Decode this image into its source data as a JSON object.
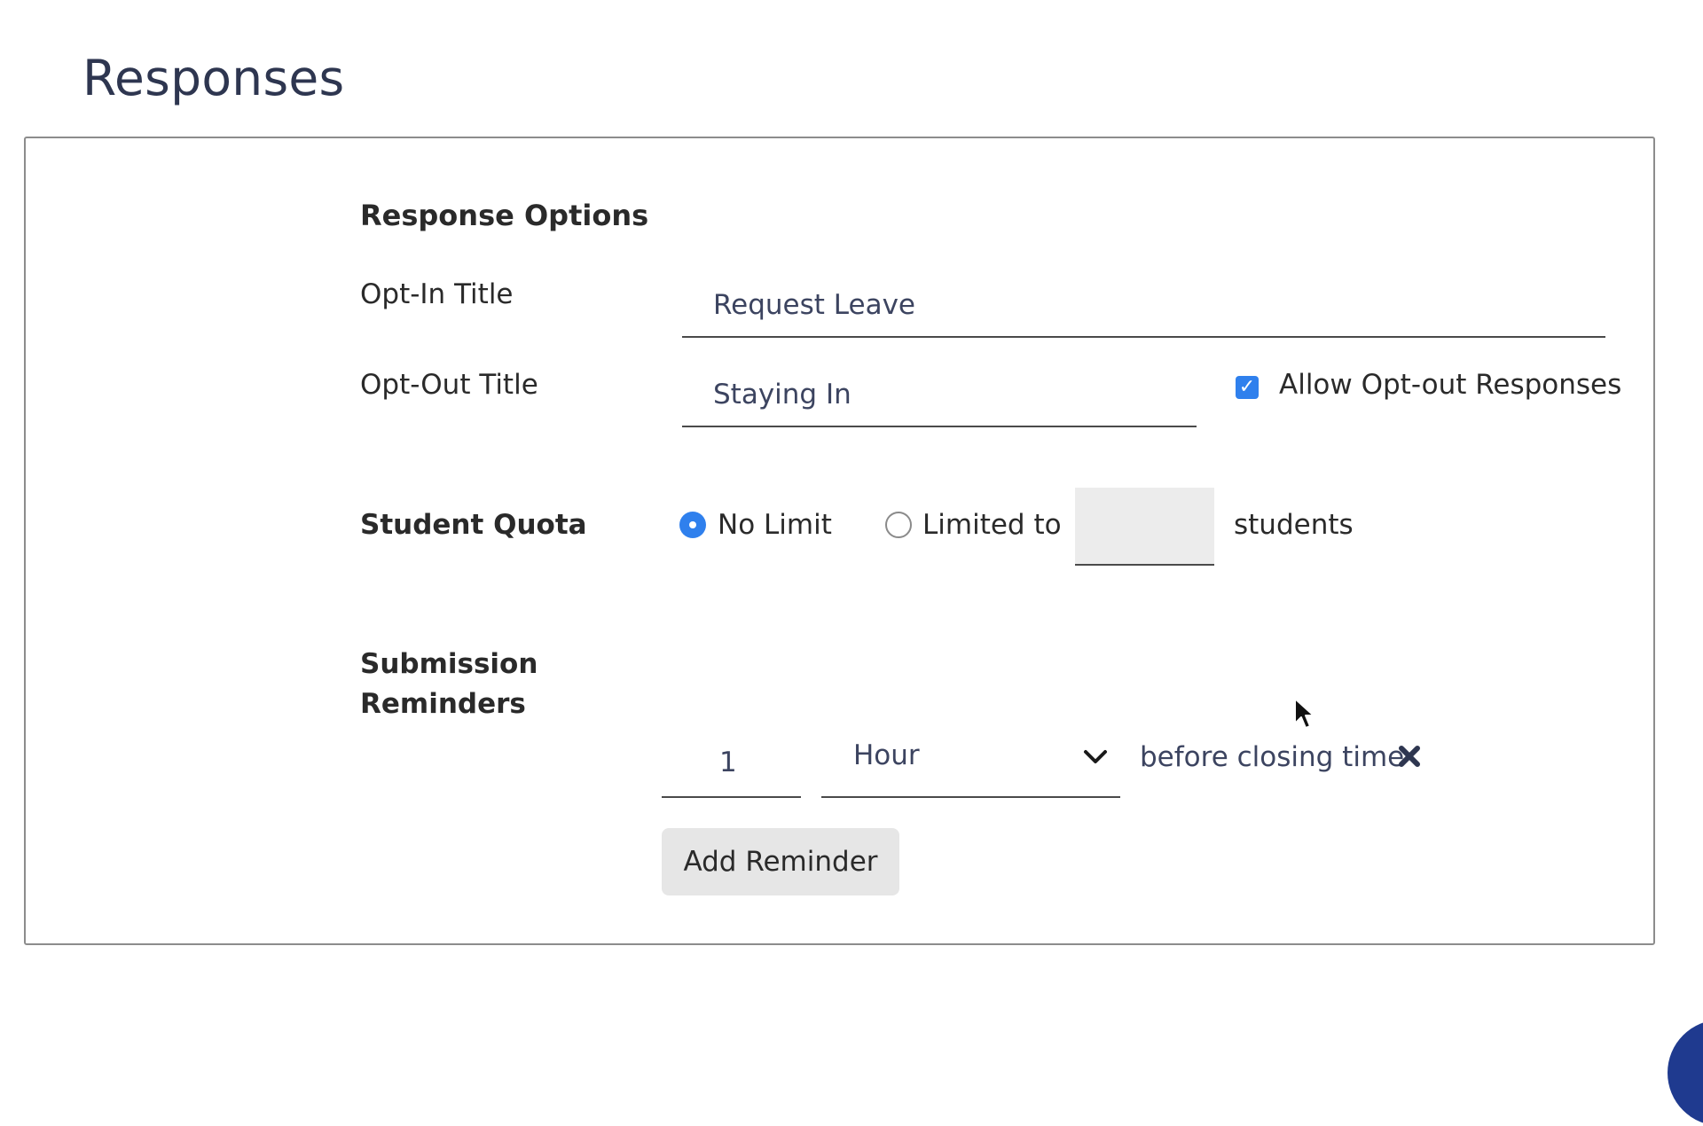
{
  "page": {
    "title": "Responses"
  },
  "response_options": {
    "heading": "Response Options",
    "opt_in": {
      "label": "Opt-In Title",
      "value": "Request Leave"
    },
    "opt_out": {
      "label": "Opt-Out Title",
      "value": "Staying In",
      "allow_label": "Allow Opt-out Responses",
      "allow_checked": true
    }
  },
  "student_quota": {
    "label": "Student Quota",
    "options": [
      {
        "label": "No Limit",
        "selected": true
      },
      {
        "label": "Limited to",
        "selected": false
      }
    ],
    "limit_value": "",
    "suffix": "students"
  },
  "submission_reminders": {
    "label_line1": "Submission",
    "label_line2": "Reminders",
    "reminders": [
      {
        "amount": "1",
        "unit": "Hour",
        "suffix": "before closing time"
      }
    ],
    "add_button_label": "Add Reminder"
  },
  "icons": {
    "checkbox": "check-icon",
    "select": "chevron-down-icon",
    "remove": "close-icon",
    "pointer": "mouse-cursor-icon"
  },
  "colors": {
    "accent": "#2f80ed",
    "title": "#2e3650",
    "input_text": "#3c4460",
    "button_bg": "#e6e6e6"
  }
}
